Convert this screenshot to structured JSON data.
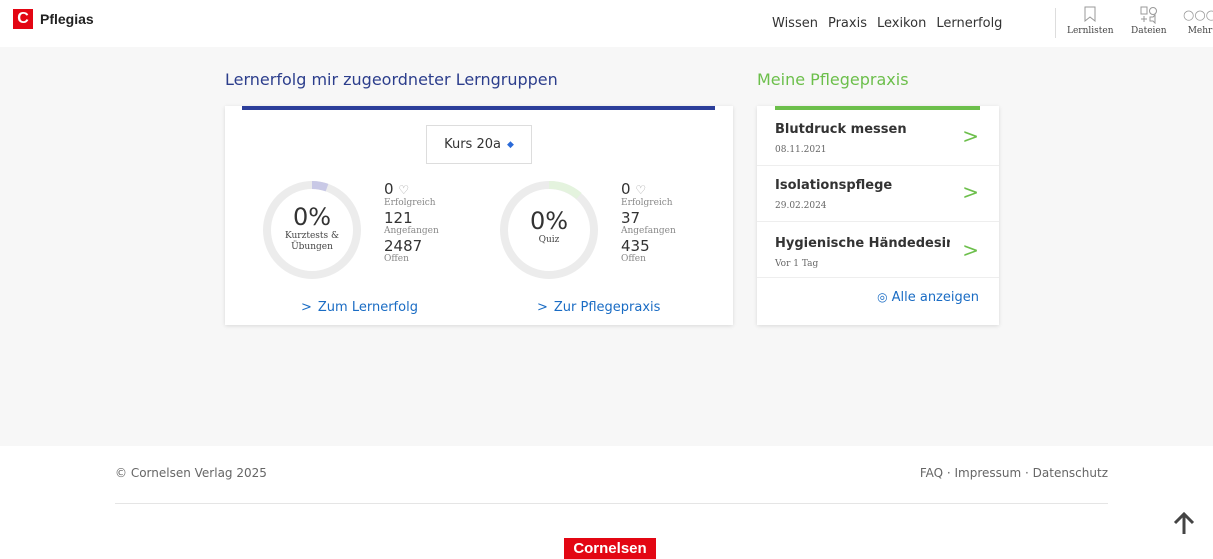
{
  "header": {
    "logo_letter": "C",
    "brand": "Pflegias",
    "nav": [
      "Wissen",
      "Praxis",
      "Lexikon",
      "Lernerfolg"
    ],
    "tools": [
      {
        "label": "Lernlisten",
        "icon": "bookmark-icon"
      },
      {
        "label": "Dateien",
        "icon": "files-icon"
      },
      {
        "label": "Mehr",
        "icon": "more-icon"
      }
    ]
  },
  "lernerfolg": {
    "title": "Lernerfolg mir zugeordneter Lerngruppen",
    "course_select": "Kurs 20a",
    "accent": "#2c3e9a",
    "rings": [
      {
        "percent": "0%",
        "label_line1": "Kurztests &",
        "label_line2": "Übungen",
        "successful": "0",
        "successful_label": "Erfolgreich",
        "started": "121",
        "started_label": "Angefangen",
        "open": "2487",
        "open_label": "Offen",
        "ring_color": "#c9c9e6"
      },
      {
        "percent": "0%",
        "label_line1": "Quiz",
        "label_line2": "",
        "successful": "0",
        "successful_label": "Erfolgreich",
        "started": "37",
        "started_label": "Angefangen",
        "open": "435",
        "open_label": "Offen",
        "ring_color": "#d8efcf"
      }
    ],
    "link_lernerfolg": "Zum Lernerfolg",
    "link_pflegepraxis": "Zur Pflegepraxis"
  },
  "pflegepraxis": {
    "title": "Meine Pflegepraxis",
    "accent": "#6cbf4b",
    "items": [
      {
        "title": "Blutdruck messen",
        "date": "08.11.2021"
      },
      {
        "title": "Isolationspflege",
        "date": "29.02.2024"
      },
      {
        "title": "Hygienische Händedesinfektion",
        "date": "Vor 1 Tag"
      }
    ],
    "show_all": "Alle anzeigen"
  },
  "footer": {
    "copyright": "© Cornelsen Verlag 2025",
    "links": "FAQ · Impressum · Datenschutz",
    "logo": "Cornelsen"
  }
}
